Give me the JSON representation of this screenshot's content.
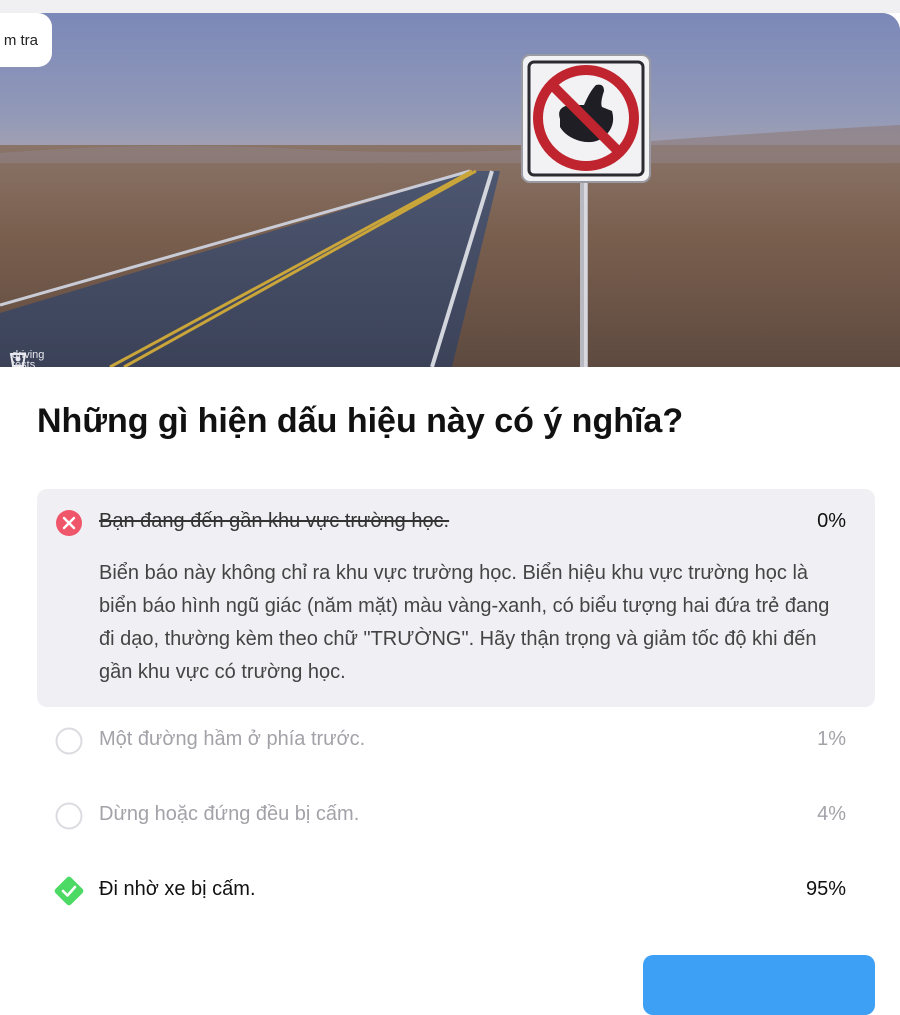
{
  "header": {
    "badge_label": "m tra"
  },
  "hero": {
    "watermark": "driving\ntests"
  },
  "question": {
    "title": "Những gì hiện dấu hiệu này có ý nghĩa?"
  },
  "answers": [
    {
      "text": "Bạn đang đến gần khu vực trường học.",
      "percent": "0%",
      "state": "wrong",
      "explanation": "Biển báo này không chỉ ra khu vực trường học. Biển hiệu khu vực trường học là biển báo hình ngũ giác (năm mặt) màu vàng-xanh, có biểu tượng hai đứa trẻ đang đi dạo, thường kèm theo chữ \"TRƯỜNG\". Hãy thận trọng và giảm tốc độ khi đến gần khu vực có trường học."
    },
    {
      "text": "Một đường hầm ở phía trước.",
      "percent": "1%",
      "state": "neutral"
    },
    {
      "text": "Dừng hoặc đứng đều bị cấm.",
      "percent": "4%",
      "state": "neutral"
    },
    {
      "text": "Đi nhờ xe bị cấm.",
      "percent": "95%",
      "state": "correct"
    }
  ],
  "colors": {
    "accent": "#3ea0f5",
    "wrong": "#f0566a",
    "correct": "#4cd964",
    "panel": "#f0eff4"
  },
  "icons": [
    "close-circle-icon",
    "radio-empty-icon",
    "check-diamond-icon",
    "no-hitchhiking-sign"
  ]
}
